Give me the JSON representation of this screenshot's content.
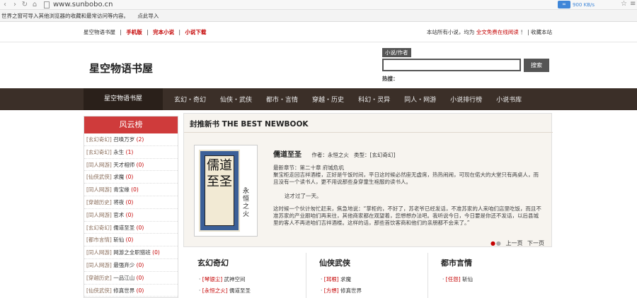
{
  "browser": {
    "url": "www.sunbobo.cn",
    "speed": "900 KB/s",
    "speed_icon": "cloud-speed-icon",
    "bookmark_text": "世界之窗可导入其他浏览器的收藏和最常访问等内容。",
    "bookmark_action": "点此导入"
  },
  "topbar": {
    "left_site": "星空物语书屋",
    "links": [
      "手机版",
      "完本小说",
      "小说下载"
    ],
    "right_prefix": "本站所有小说，均为",
    "right_highlight": "全文免费在线阅读",
    "right_suffix": "！ | 收藏本站"
  },
  "header": {
    "logo": "星空物语书屋",
    "search_tab": "小说/作者",
    "search_value": "",
    "search_button": "搜索",
    "hot_label": "热搜："
  },
  "nav": {
    "home": "星空物语书屋",
    "items": [
      "玄幻・奇幻",
      "仙侠・武侠",
      "都市・言情",
      "穿越・历史",
      "科幻・灵异",
      "同人・网游",
      "小说排行榜",
      "小说书库"
    ]
  },
  "ranking": {
    "title": "风云榜",
    "items": [
      {
        "cat": "[玄幻奇幻]",
        "name": "召唤万岁",
        "count": "(2)"
      },
      {
        "cat": "[玄幻奇幻]",
        "name": "永生",
        "count": "(1)"
      },
      {
        "cat": "[同人网游]",
        "name": "天才相师",
        "count": "(0)"
      },
      {
        "cat": "[仙侠武侠]",
        "name": "求魔",
        "count": "(0)"
      },
      {
        "cat": "[同人网游]",
        "name": "青宝缘",
        "count": "(0)"
      },
      {
        "cat": "[穿越历史]",
        "name": "将夜",
        "count": "(0)"
      },
      {
        "cat": "[同人网游]",
        "name": "官术",
        "count": "(0)"
      },
      {
        "cat": "[玄幻奇幻]",
        "name": "儒道至圣",
        "count": "(0)"
      },
      {
        "cat": "[都市言情]",
        "name": "斩仙",
        "count": "(0)"
      },
      {
        "cat": "[同人网游]",
        "name": "网游之全职猎班",
        "count": "(0)"
      },
      {
        "cat": "[同人网游]",
        "name": "最强弃少",
        "count": "(0)"
      },
      {
        "cat": "[穿越历史]",
        "name": "一品江山",
        "count": "(0)"
      },
      {
        "cat": "[仙侠武侠]",
        "name": "修真世界",
        "count": "(0)"
      }
    ]
  },
  "featured": {
    "section_title": "封推新书 THE BEST NEWBOOK",
    "cover_title": "儒道至圣",
    "cover_author": "永恒之火",
    "book_name": "儒道至圣",
    "author_label": "作者：永恒之火",
    "type_label": "类型：[玄幻奇幻]",
    "latest": "最新章节：第二十章 府城危机",
    "para1": "  聚宝柜走回吉祥酒楼，正好是午饭时间，平日这时候必然座无虚席，热热闹闹，可现在偌大的大堂只有两桌人，而且没有一个读书人，更不用说那些身穿童生袍服的读书人。",
    "para2": "这才过了一天。",
    "para3": "  这时候一个伙计匆忙赶来，焦急地说：“掌柜的，不好了，苏老爷已经发话，不准苏家的人来咱们店里吃饭，而且不准苏家的产业跟咱们再来往，其他商家都在观望着，您想想办法吧。我听说今日，今日要是你还不发话，以后县城里的客人不再进咱们吉祥酒楼。这样的话，那些首饮客商和他们的亲朋都不会来了。”",
    "prev": "上一页",
    "next": "下一页"
  },
  "categories": [
    {
      "title": "玄幻奇幻",
      "rows": [
        {
          "tag": "[琴银尘]",
          "name": "武神空间"
        },
        {
          "tag": "[永恒之火]",
          "name": "儒道至圣"
        }
      ]
    },
    {
      "title": "仙侠武侠",
      "rows": [
        {
          "tag": "[耳根]",
          "name": "求魔"
        },
        {
          "tag": "[方想]",
          "name": "修真世界"
        }
      ]
    },
    {
      "title": "都市言情",
      "rows": [
        {
          "tag": "[任怨]",
          "name": "斩仙"
        }
      ]
    }
  ]
}
